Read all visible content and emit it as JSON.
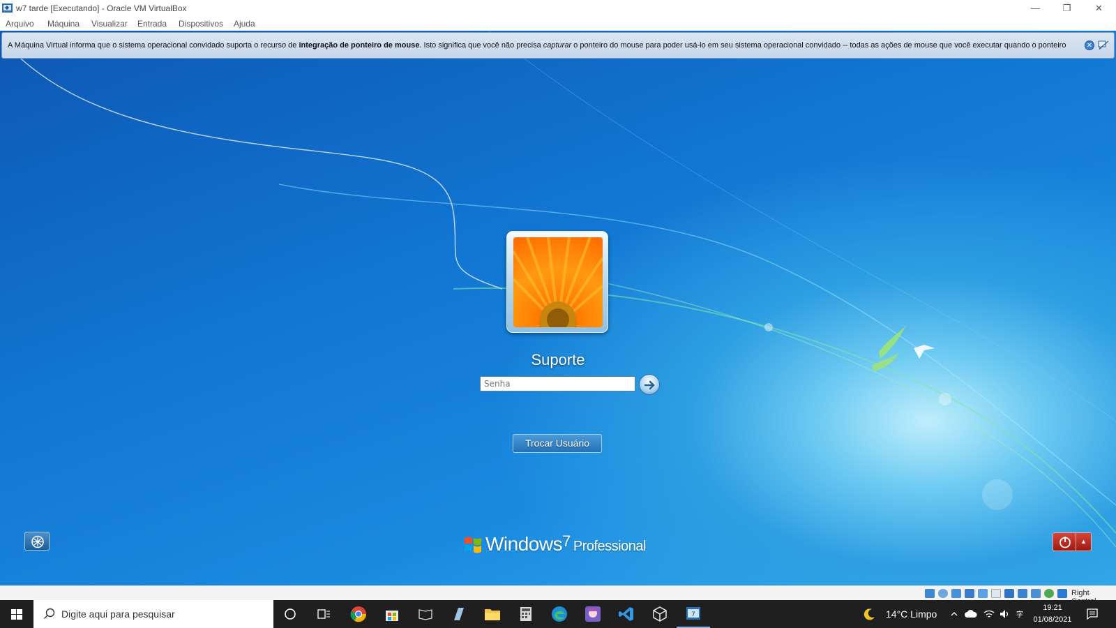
{
  "window": {
    "title": "w7 tarde [Executando] - Oracle VM VirtualBox",
    "minimize": "—",
    "maximize": "❐",
    "close": "✕"
  },
  "menu": {
    "items": [
      "Arquivo",
      "Máquina",
      "Visualizar",
      "Entrada",
      "Dispositivos",
      "Ajuda"
    ]
  },
  "notification": {
    "part1": "A Máquina Virtual informa que o sistema operacional convidado suporta o recurso de ",
    "bold": "integração de ponteiro de mouse",
    "part2": ". Isto significa que você não precisa ",
    "italic": "capturar",
    "part3": " o ponteiro do mouse para poder usá-lo em seu sistema operacional convidado -- todas as ações de mouse que você executar quando o ponteiro",
    "close_glyph": "✕"
  },
  "login": {
    "username": "Suporte",
    "password_placeholder": "Senha",
    "password_value": "",
    "switch_user_label": "Trocar Usuário",
    "brand_windows": "Windows",
    "brand_version": "7",
    "brand_edition": "Professional",
    "power_arrow": "▲"
  },
  "statusbar": {
    "host_key": "Right Control"
  },
  "taskbar": {
    "search_placeholder": "Digite aqui para pesquisar",
    "weather": "14°C  Limpo",
    "time": "19:21",
    "date": "01/08/2021"
  },
  "colors": {
    "desktop_blue": "#1176d2",
    "taskbar": "#1f1f1f",
    "power_red": "#c0302a"
  }
}
